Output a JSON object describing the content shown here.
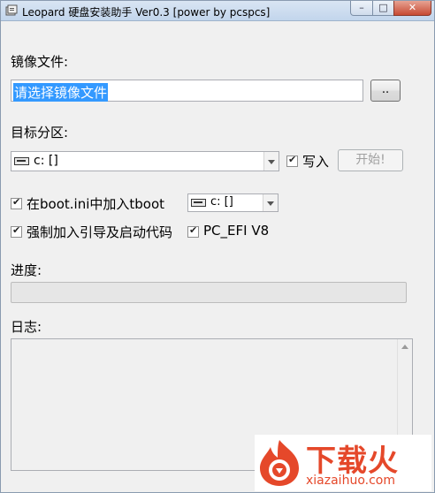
{
  "window": {
    "title": "Leopard 硬盘安装助手 Ver0.3 [power by pcspcs]",
    "close_glyph": "✕",
    "max_glyph": "□",
    "min_glyph": "–"
  },
  "image_file": {
    "label": "镜像文件:",
    "value": "请选择镜像文件",
    "browse_label": ".."
  },
  "target": {
    "label": "目标分区:",
    "drive_value": "c: []",
    "drive_icon": "drive-icon",
    "write_checked": true,
    "write_label": "写入",
    "start_label": "开始!"
  },
  "options": {
    "bootini_checked": true,
    "bootini_label": "在boot.ini中加入tboot",
    "bootini_drive": "c: []",
    "force_checked": true,
    "force_label": "强制加入引导及启动代码",
    "efi_checked": true,
    "efi_label": "PC_EFI V8"
  },
  "progress": {
    "label": "进度:",
    "value": 0
  },
  "log": {
    "label": "日志:"
  },
  "watermark": {
    "text": "下载火",
    "url": "xiazaihuo.com"
  },
  "colors": {
    "accent": "#3399ff",
    "watermark": "#e5482a"
  }
}
